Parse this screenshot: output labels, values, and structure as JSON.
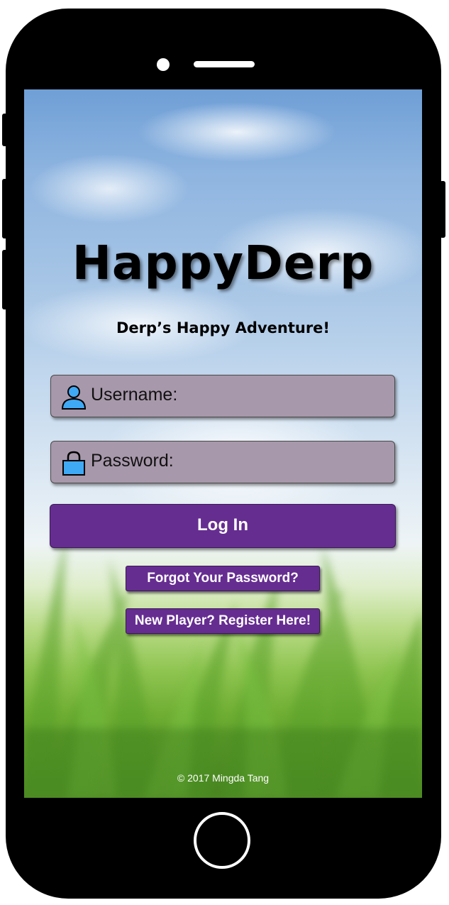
{
  "app": {
    "title": "HappyDerp",
    "subtitle": "Derp’s Happy Adventure!"
  },
  "login_form": {
    "username_label": "Username:",
    "password_label": "Password:",
    "login_label": "Log In"
  },
  "links": {
    "forgot_password_label": "Forgot Your Password?",
    "register_label": "New Player? Register Here!"
  },
  "footer": {
    "copyright": "© 2017 Mingda Tang"
  },
  "icons": {
    "user": "user-icon",
    "lock": "lock-icon"
  },
  "colors": {
    "accent_purple": "#662d91",
    "field_background": "#a898ab",
    "icon_blue": "#3fa9f5",
    "phone_body": "#000000"
  }
}
